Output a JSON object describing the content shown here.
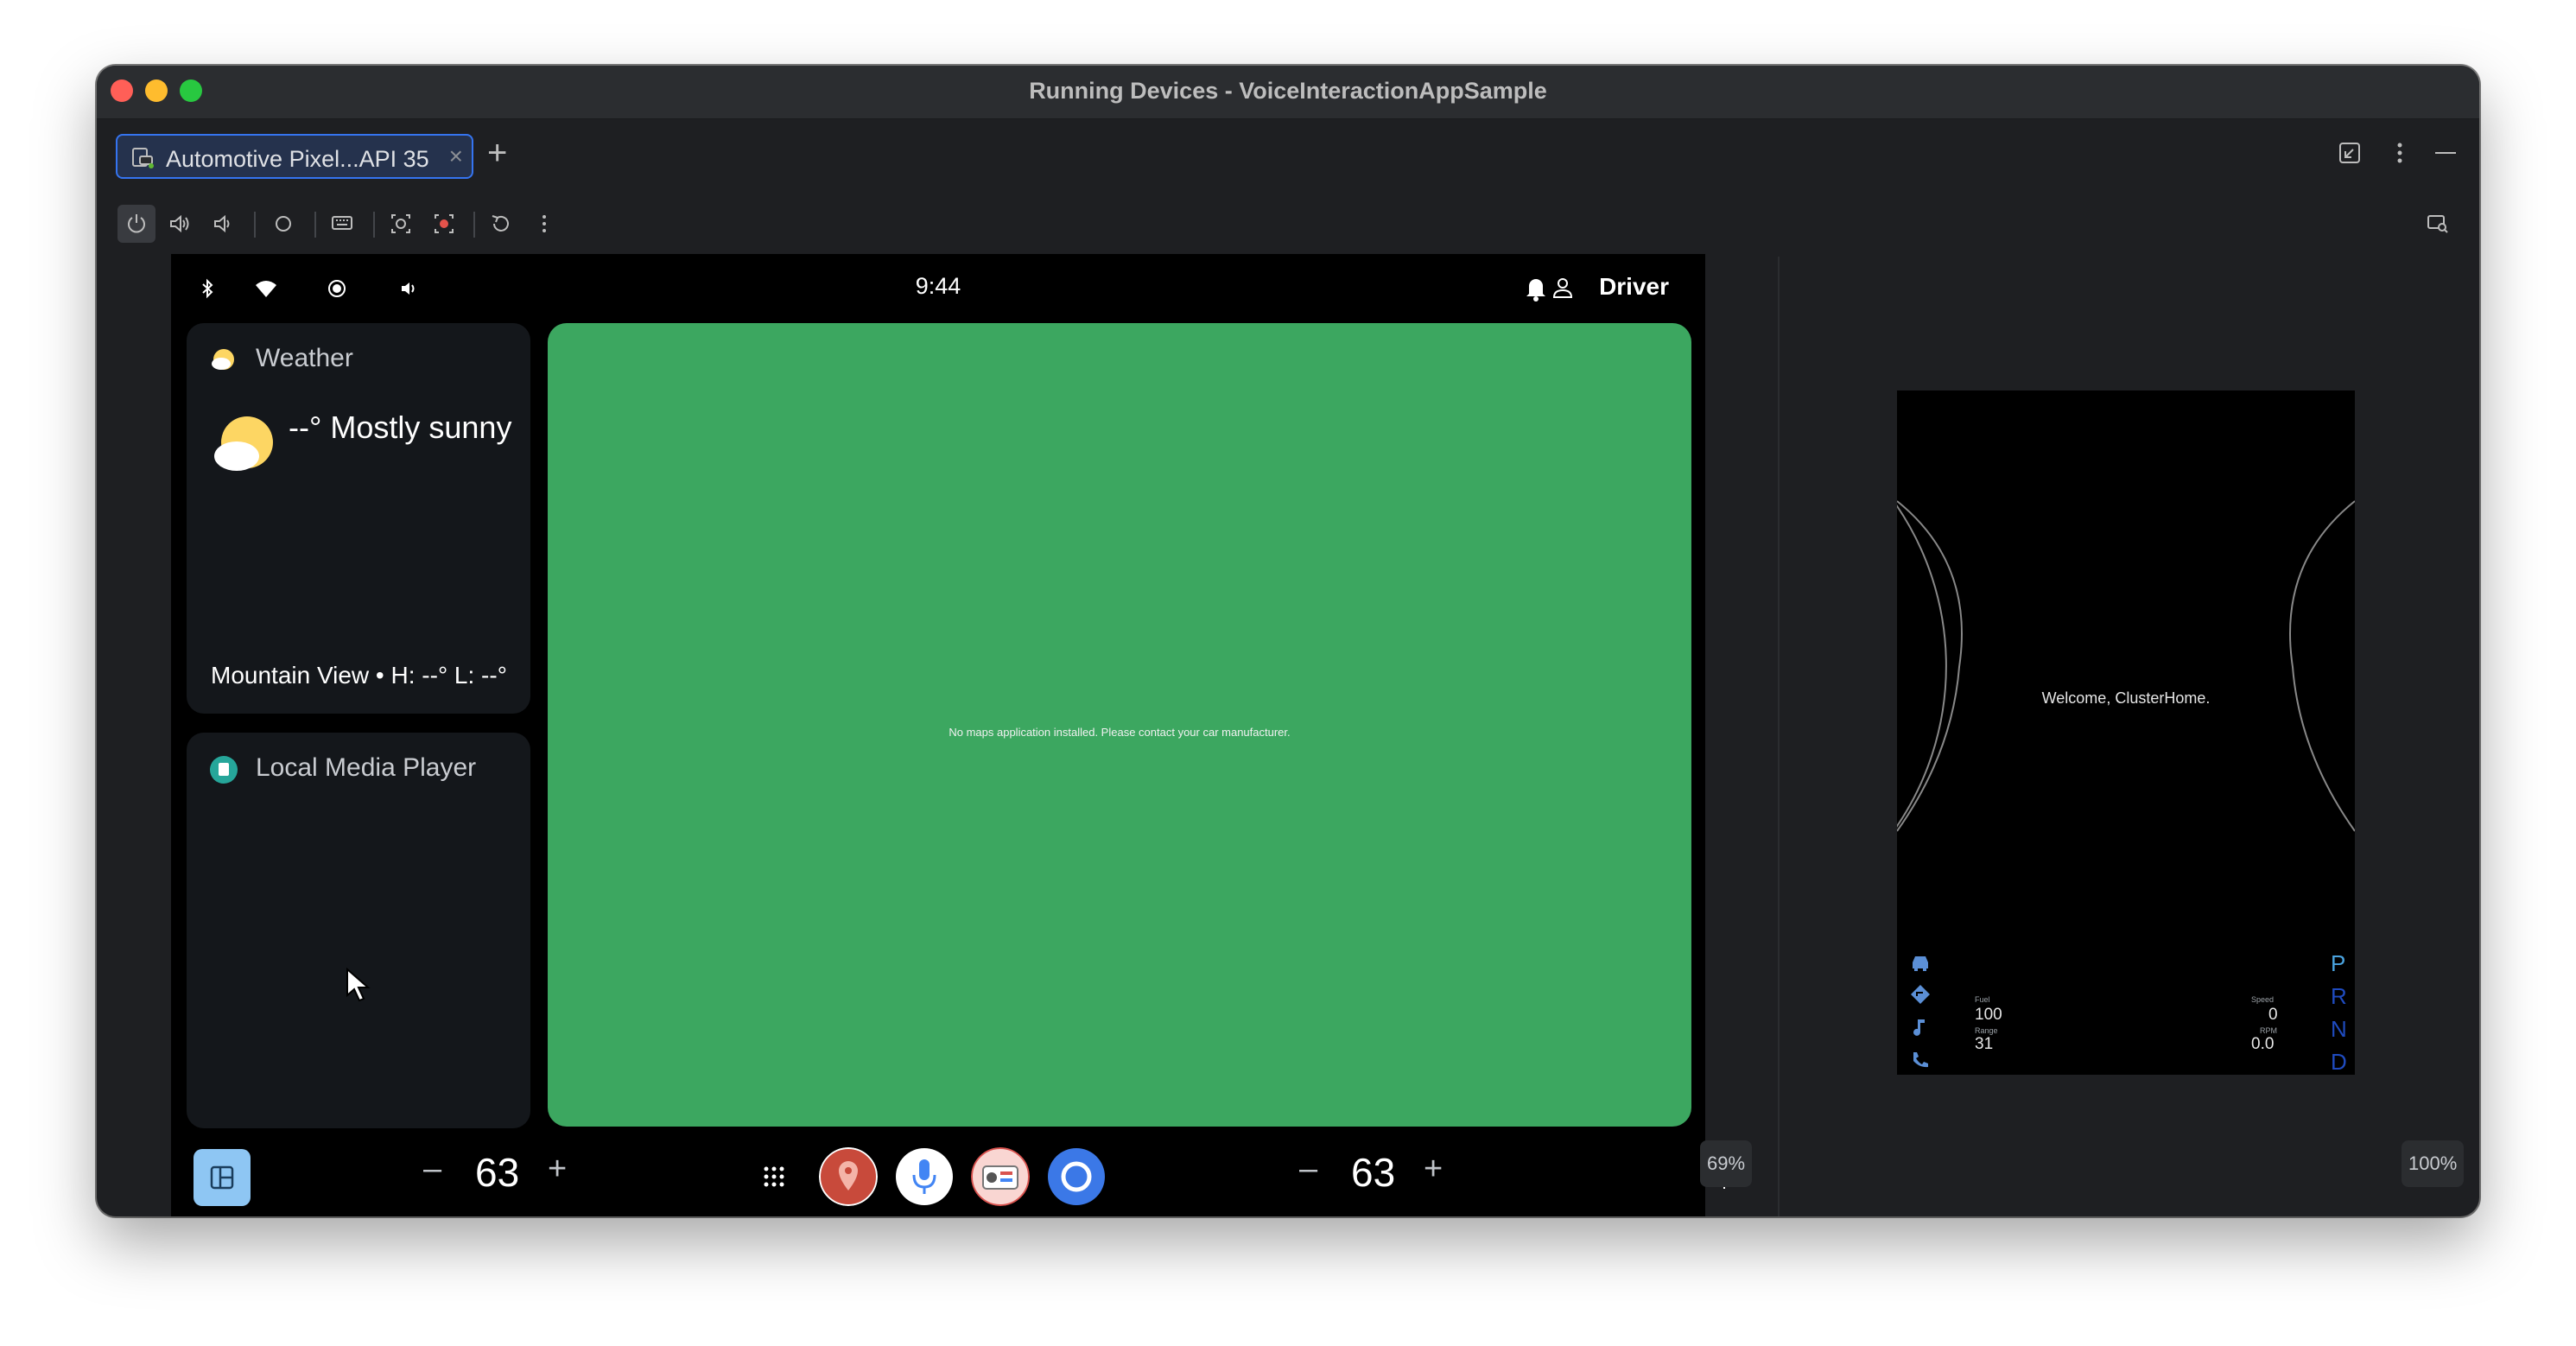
{
  "window": {
    "title": "Running Devices - VoiceInteractionAppSample"
  },
  "tabs": [
    {
      "label": "Automotive Pixel...API 35",
      "close": "×"
    }
  ],
  "tab_add": "+",
  "device": {
    "status_bar": {
      "time": "9:44",
      "user": "Driver"
    },
    "weather_card": {
      "title": "Weather",
      "temperature": "--° Mostly sunny",
      "location": "Mountain View • H: --° L: --°"
    },
    "media_card": {
      "title": "Local Media Player"
    },
    "map": {
      "message": "No maps application installed. Please contact your car manufacturer."
    },
    "nav_bar": {
      "left_volume": "63",
      "right_volume": "63",
      "minus": "–",
      "plus": "+",
      "apps": [
        "maps-app",
        "assistant-app",
        "radio-app",
        "browser-app"
      ]
    },
    "zoom": "69%"
  },
  "cluster": {
    "welcome": "Welcome, ClusterHome.",
    "fuel_label": "Fuel",
    "fuel_value": "100",
    "range_label": "Range",
    "range_value": "31",
    "speed_label": "Speed",
    "speed_value": "0",
    "rpm_label": "RPM",
    "rpm_value": "0.0",
    "gears": [
      "P",
      "R",
      "N",
      "D"
    ],
    "selected_gear": "P",
    "zoom": "100%"
  },
  "colors": {
    "accent": "#3574f0",
    "map_green": "#3ca760",
    "home_button": "#8ec6f3",
    "gear_active": "#4aa3df",
    "gear_inactive": "#1f4bbf"
  }
}
